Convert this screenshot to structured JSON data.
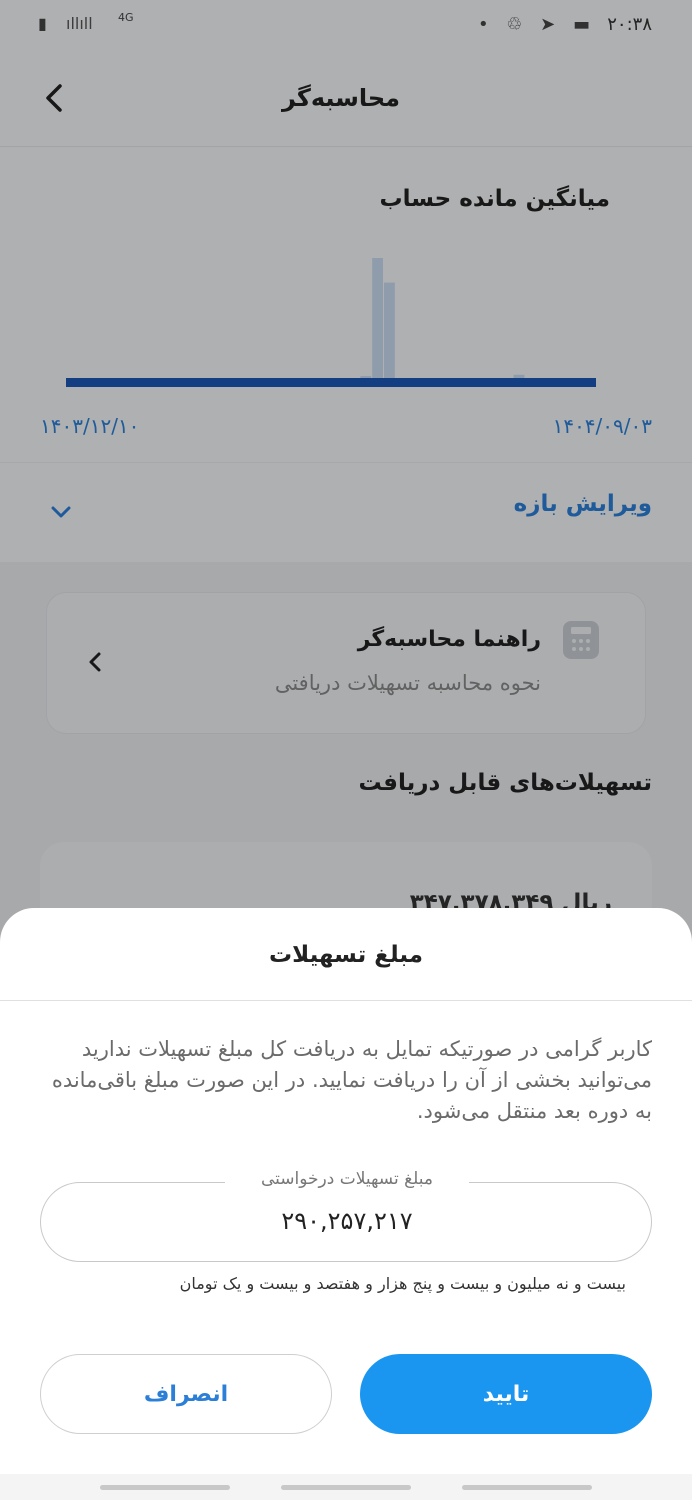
{
  "status_bar": {
    "time": "۲۰:۳۸",
    "network": "4G"
  },
  "header": {
    "title": "محاسبه‌گر"
  },
  "chart_data": {
    "type": "bar",
    "title": "میانگین مانده حساب",
    "x_start_label": "۱۴۰۳/۱۲/۱۰",
    "x_end_label": "۱۴۰۴/۰۹/۰۳",
    "values": [
      0,
      0,
      0,
      0,
      0,
      0,
      0,
      0,
      0,
      0,
      0,
      0,
      0,
      0,
      0,
      0,
      0,
      0,
      0,
      0,
      0,
      0,
      0,
      0,
      0,
      0.04,
      1.0,
      0.8,
      0,
      0,
      0,
      0,
      0,
      0,
      0,
      0,
      0,
      0,
      0.05,
      0,
      0,
      0,
      0,
      0,
      0
    ],
    "ylim": [
      0,
      1
    ],
    "grid": false,
    "colors": {
      "bar": "#c5d8ee",
      "baseline": "#1c57b5"
    }
  },
  "edit_range": {
    "label": "ویرایش بازه"
  },
  "guide": {
    "title": "راهنما محاسبه‌گر",
    "subtitle": "نحوه محاسبه تسهیلات دریافتی"
  },
  "facilities": {
    "title": "تسهیلات‌های قابل دریافت",
    "card_amount": "۳۴۷,۳۷۸,۳۴۹ ریال"
  },
  "sheet": {
    "title": "مبلغ تسهیلات",
    "message": "کاربر گرامی در صورتیکه تمایل به دریافت کل مبلغ تسهیلات ندارید می‌توانید بخشی از آن را دریافت نمایید. در این صورت مبلغ باقی‌مانده به دوره بعد منتقل می‌شود.",
    "field_label": "مبلغ تسهیلات درخواستی",
    "field_value": "۲۹۰,۲۵۷,۲۱۷",
    "amount_in_words": "بیست و نه میلیون و بیست و پنج هزار و هفتصد و بیست و یک تومان",
    "confirm_label": "تایید",
    "cancel_label": "انصراف"
  },
  "colors": {
    "accent": "#1a96f0",
    "link": "#2c7fd6"
  }
}
